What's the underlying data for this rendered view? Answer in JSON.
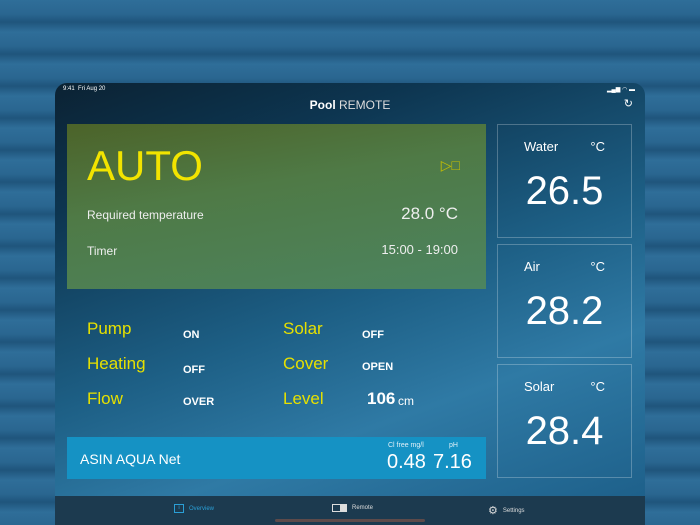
{
  "status": {
    "time": "9:41",
    "date": "Fri Aug 20",
    "icons": "signal wifi battery"
  },
  "header": {
    "title_bold": "Pool",
    "title_light": "REMOTE",
    "refresh_icon": "↻"
  },
  "mode_panel": {
    "mode": "AUTO",
    "controls": "▷□",
    "required_label": "Required temperature",
    "required_value": "28.0 °C",
    "timer_label": "Timer",
    "timer_value": "15:00 - 19:00"
  },
  "states": [
    {
      "label": "Pump",
      "value": "ON"
    },
    {
      "label": "Heating",
      "value": "OFF"
    },
    {
      "label": "Flow",
      "value": "OVER"
    },
    {
      "label": "Solar",
      "value": "OFF"
    },
    {
      "label": "Cover",
      "value": "OPEN"
    },
    {
      "label": "Level",
      "value": "106",
      "unit": "cm"
    }
  ],
  "aqua": {
    "name": "ASIN AQUA Net",
    "cl_label": "Cl free mg/l",
    "cl_value": "0.48",
    "ph_label": "pH",
    "ph_value": "7.16"
  },
  "cards": [
    {
      "label": "Water",
      "unit": "°C",
      "value": "26.5"
    },
    {
      "label": "Air",
      "unit": "°C",
      "value": "28.2"
    },
    {
      "label": "Solar",
      "unit": "°C",
      "value": "28.4"
    }
  ],
  "tabs": [
    {
      "label": "Overview"
    },
    {
      "label": "Remote"
    },
    {
      "label": "Settings"
    }
  ],
  "colors": {
    "accent": "#2a9fd6",
    "status_yellow": "#e6e000",
    "net_blue": "#1592c4"
  }
}
